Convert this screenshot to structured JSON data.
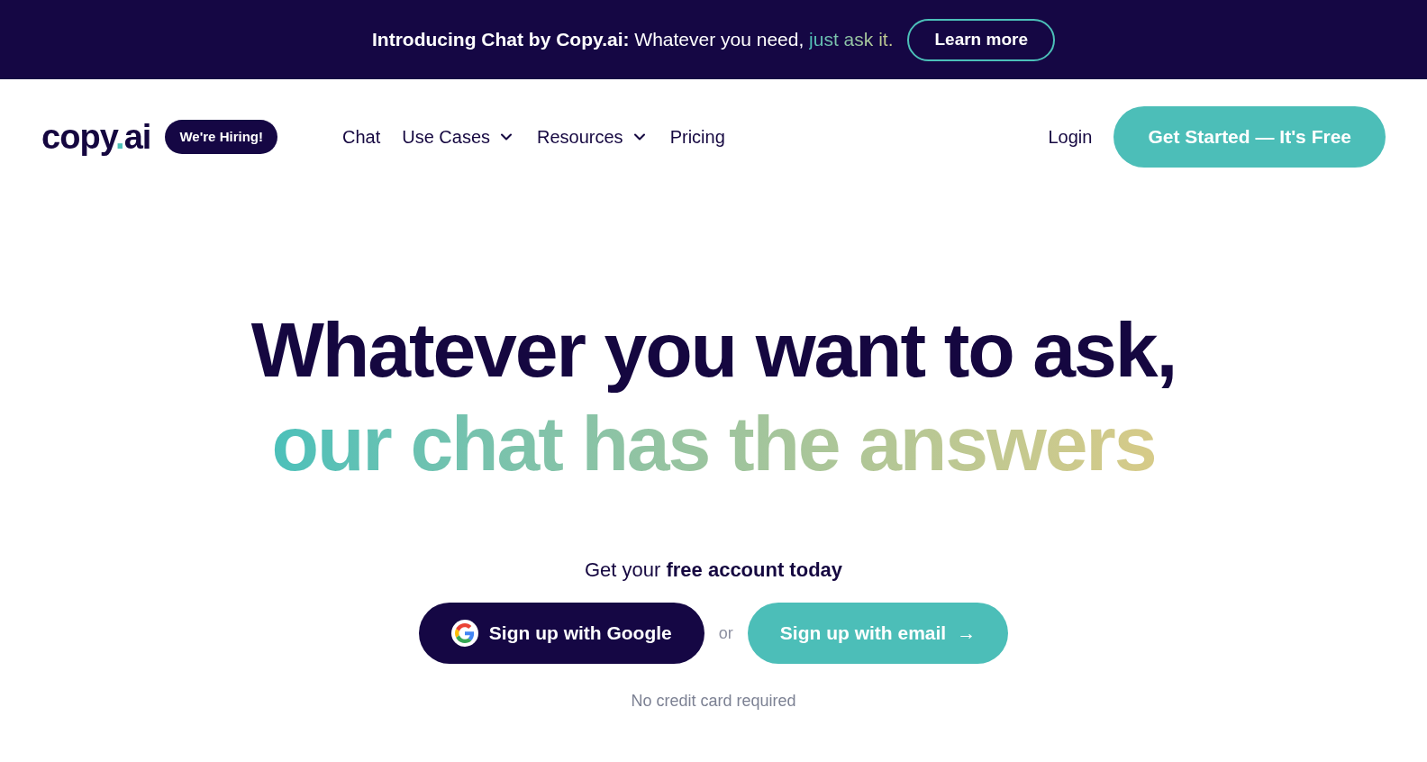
{
  "banner": {
    "text": "**Introducing Chat by Copy.ai:** Whatever you need, ",
    "highlight": "just ask it.",
    "button": "Learn more"
  },
  "header": {
    "logo": [
      {
        "text": "copy",
        "kind": "plain"
      },
      {
        "text": ".",
        "kind": "accent"
      },
      {
        "text": "ai",
        "kind": "plain"
      }
    ],
    "badge": "We're Hiring!",
    "nav": [
      {
        "label": "Chat",
        "has_dropdown": false
      },
      {
        "label": "Use Cases",
        "has_dropdown": true
      },
      {
        "label": "Resources",
        "has_dropdown": true
      },
      {
        "label": "Pricing",
        "has_dropdown": false
      }
    ],
    "login": "Login",
    "cta": "Get Started — It's Free"
  },
  "hero": {
    "title_line_1": "Whatever you want to ask,",
    "title_line_2": "our chat has the answers",
    "subtitle": "Get your **free account today**",
    "google_button": "Sign up with Google",
    "separator": "or",
    "email_button": "Sign up with email",
    "email_button_arrow": "→",
    "note": "No credit card required"
  }
}
